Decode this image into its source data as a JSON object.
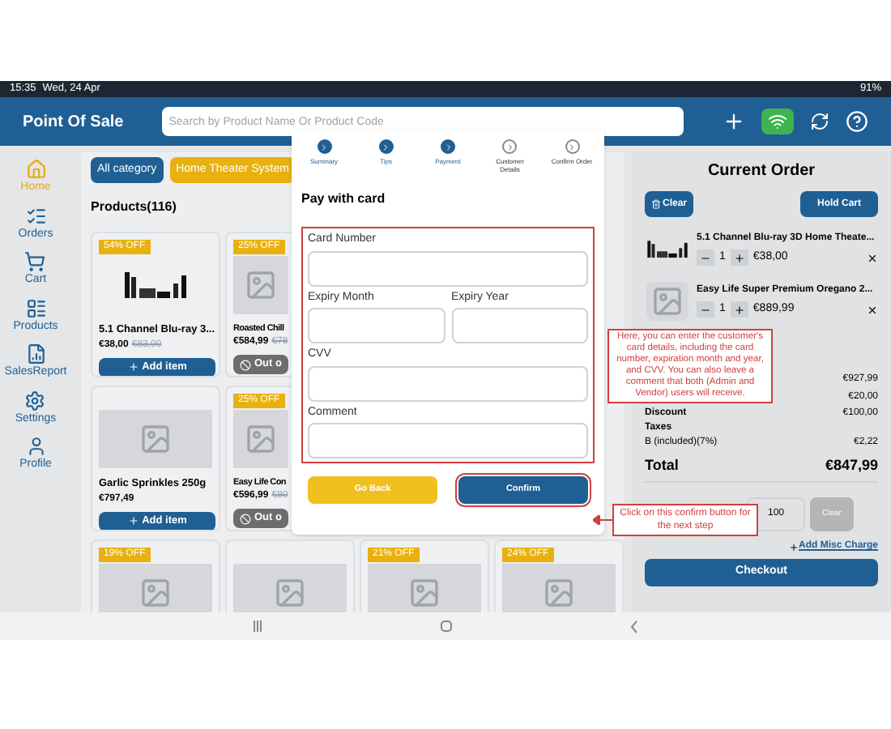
{
  "status_bar": {
    "time": "15:35",
    "date": "Wed, 24 Apr",
    "battery": "91%"
  },
  "header": {
    "title": "Point Of Sale",
    "search": {
      "placeholder": "Search by Product Name Or Product Code"
    }
  },
  "sidebar": {
    "items": [
      {
        "label": "Home",
        "selected": true
      },
      {
        "label": "Orders",
        "selected": false
      },
      {
        "label": "Cart",
        "selected": false
      },
      {
        "label": "Products",
        "selected": false
      },
      {
        "label": "SalesReport",
        "selected": false
      },
      {
        "label": "Settings",
        "selected": false
      },
      {
        "label": "Profile",
        "selected": false
      }
    ]
  },
  "categories": [
    {
      "label": "All category",
      "selected": true
    },
    {
      "label": "Home Theater System",
      "selected": false
    }
  ],
  "products_title": "Products(116)",
  "product_rows": [
    [
      {
        "badge": "54% OFF",
        "name": "5.1 Channel Blu-ray 3...",
        "price": "€38,00",
        "old_price": "€83,00",
        "action": "Add item",
        "in_stock": true
      },
      {
        "badge": "25% OFF",
        "name": "Roasted Chill",
        "price": "€584,99",
        "old_price": "€78",
        "action": "Out o",
        "in_stock": false
      }
    ],
    [
      {
        "name": "Garlic Sprinkles 250g",
        "price": "€797,49",
        "action": "Add item",
        "in_stock": true
      },
      {
        "badge": "25% OFF",
        "name": "Easy Life Con",
        "price": "€596,99",
        "old_price": "€80",
        "action": "Out o",
        "in_stock": false
      }
    ],
    [
      {
        "badge": "19% OFF"
      },
      {},
      {
        "badge": "21% OFF"
      },
      {
        "badge": "24% OFF"
      }
    ]
  ],
  "modal": {
    "steps": [
      {
        "label": "Summary",
        "done": true
      },
      {
        "label": "Tips",
        "done": true
      },
      {
        "label": "Payment",
        "done": true
      },
      {
        "label": "Customer Details",
        "done": false
      },
      {
        "label": "Confirm Order",
        "done": false
      }
    ],
    "title": "Pay with card",
    "fields": [
      {
        "label": "Card Number"
      },
      {
        "label": "Expiry Month"
      },
      {
        "label": "Expiry Year"
      },
      {
        "label": "CVV"
      },
      {
        "label": "Comment"
      }
    ],
    "buttons": [
      {
        "label": "Go Back",
        "kind": "secondary"
      },
      {
        "label": "Confirm",
        "kind": "primary"
      }
    ]
  },
  "callouts": [
    "Here, you can enter the customer's card details, including the card number, expiration month and year, and CVV. You can also leave a comment that both (Admin and Vendor) users will receive.",
    "Click on this confirm button for the next step"
  ],
  "order": {
    "title": "Current Order",
    "clear": "Clear",
    "hold": "Hold Cart",
    "items": [
      {
        "name": "5.1 Channel Blu-ray 3D Home Theate...",
        "qty": "1",
        "price": "€38,00"
      },
      {
        "name": "Easy Life Super Premium Oregano 2...",
        "qty": "1",
        "price": "€889,99"
      }
    ],
    "amounts": [
      "€927,99",
      "€20,00"
    ],
    "discount": {
      "label": "Discount",
      "value": "€100,00"
    },
    "taxes": "Taxes",
    "tax_line": {
      "label": "B (included)(7%)",
      "value": "€2,22"
    },
    "total": {
      "label": "Total",
      "value": "€847,99"
    },
    "discount_input": "100",
    "discount_clear": {
      "label": "Clear",
      "disabled": true
    },
    "misc": "Add Misc Charge",
    "checkout": "Checkout"
  }
}
